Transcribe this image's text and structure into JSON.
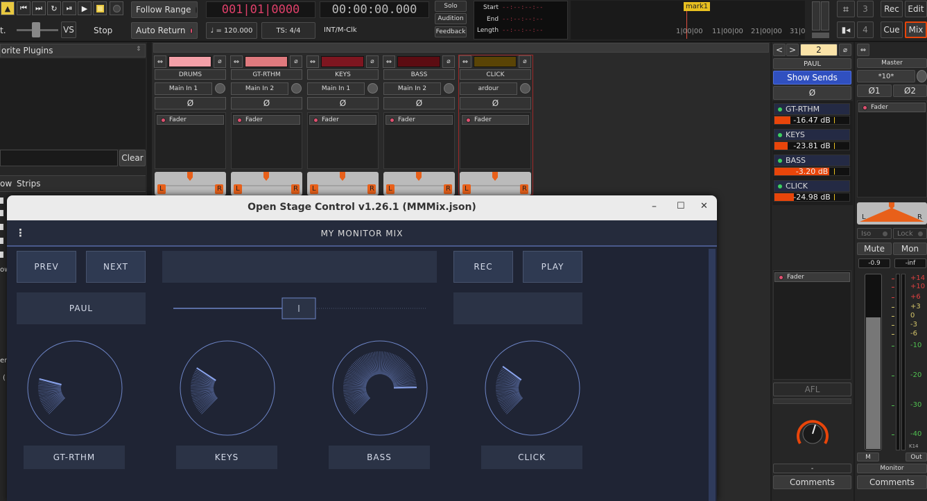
{
  "toolbar": {
    "follow_range": "Follow Range",
    "auto_return": "Auto Return",
    "bbt_clock": "001|01|0000",
    "time_clock": "00:00:00.000",
    "tempo": "♩ = 120.000",
    "ts": "TS: 4/4",
    "sync": "INT/M-Clk",
    "solo": "Solo",
    "audition": "Audition",
    "feedback": "Feedback",
    "start_label": "Start",
    "end_label": "End",
    "length_label": "Length",
    "empty_clock": "--:--:--:--",
    "vs": "VS",
    "stop": "Stop",
    "left_cut": "t.",
    "marker": "mark1",
    "ruler_ticks": [
      "1|00|00",
      "11|00|00",
      "21|00|00",
      "31|0"
    ],
    "num3": "3",
    "num4": "4",
    "rec": "Rec",
    "edit": "Edit",
    "cue": "Cue",
    "mix": "Mix"
  },
  "left_panel": {
    "title": "orite Plugins",
    "clear": "Clear",
    "tab_w": "ow",
    "tab_strips": "Strips",
    "cut_text1": "er",
    "cut_text2": "(",
    "cut_text3": "ow"
  },
  "strips": [
    {
      "name": "DRUMS",
      "input": "Main In 1",
      "phase": "Ø",
      "proc": "Fader",
      "color": "#f4a0a8",
      "L": "L",
      "R": "R"
    },
    {
      "name": "GT-RTHM",
      "input": "Main In 2",
      "phase": "Ø",
      "proc": "Fader",
      "color": "#e07a7e",
      "L": "L",
      "R": "R"
    },
    {
      "name": "KEYS",
      "input": "Main In 1",
      "phase": "Ø",
      "proc": "Fader",
      "color": "#7e1620",
      "L": "L",
      "R": "R"
    },
    {
      "name": "BASS",
      "input": "Main In 2",
      "phase": "Ø",
      "proc": "Fader",
      "color": "#5c0c12",
      "L": "L",
      "R": "R"
    },
    {
      "name": "CLICK",
      "input": "ardour",
      "phase": "Ø",
      "proc": "Fader",
      "color": "#5a4406",
      "L": "L",
      "R": "R"
    }
  ],
  "foldback": {
    "number": "2",
    "name": "PAUL",
    "show_sends": "Show Sends",
    "phase": "Ø",
    "sends": [
      {
        "name": "GT-RTHM",
        "value": "-16.47 dB",
        "level": 0.25
      },
      {
        "name": "KEYS",
        "value": "-23.81 dB",
        "level": 0.2
      },
      {
        "name": "BASS",
        "value": "-3.20 dB",
        "level": 0.85
      },
      {
        "name": "CLICK",
        "value": "-24.98 dB",
        "level": 0.3
      }
    ],
    "proc": "Fader",
    "afl": "AFL",
    "dash": "-",
    "comments": "Comments"
  },
  "master": {
    "name": "Master",
    "input": "*10*",
    "phase1": "Ø1",
    "phase2": "Ø2",
    "proc": "Fader",
    "iso": "Iso",
    "lock": "Lock",
    "mute": "Mute",
    "mon": "Mon",
    "gain": "-0.9",
    "peak": "-inf",
    "scale": [
      "+14",
      "+10",
      "+6",
      "+3",
      "0",
      "-3",
      "-6",
      "-10",
      "-20",
      "-30",
      "-40"
    ],
    "k14": "K14",
    "m": "M",
    "out": "Out",
    "monitor": "Monitor",
    "comments": "Comments",
    "L": "L",
    "R": "R"
  },
  "osc": {
    "window_title": "Open Stage Control v1.26.1 (MMMix.json)",
    "minimize": "–",
    "maximize": "☐",
    "close": "✕",
    "menu": "⋮",
    "header": "MY MONITOR MIX",
    "prev": "PREV",
    "next": "NEXT",
    "rec": "REC",
    "play": "PLAY",
    "user": "PAUL",
    "slider_value": 0.5,
    "knobs": [
      {
        "label": "GT-RTHM",
        "value": 0.22
      },
      {
        "label": "KEYS",
        "value": 0.29
      },
      {
        "label": "BASS",
        "value": 0.83
      },
      {
        "label": "CLICK",
        "value": 0.3
      }
    ]
  },
  "colors": {
    "accent_orange": "#e8450a",
    "ardour_red": "#e0406a",
    "osc_bg": "#1f2434",
    "osc_widget": "#2f3a52",
    "osc_line": "#6e86c8"
  }
}
